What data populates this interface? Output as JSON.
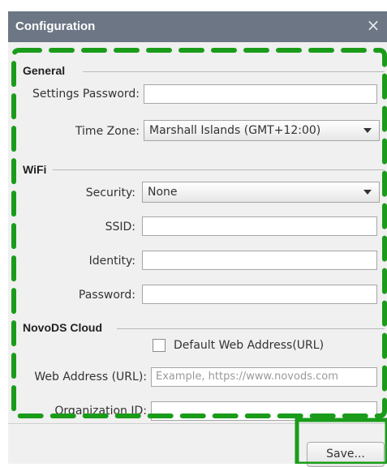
{
  "window": {
    "title": "Configuration",
    "close_glyph": "×"
  },
  "general": {
    "legend": "General",
    "settings_password_label": "Settings Password:",
    "settings_password_value": "",
    "time_zone_label": "Time Zone:",
    "time_zone_value": "Marshall Islands  (GMT+12:00)"
  },
  "wifi": {
    "legend": "WiFi",
    "security_label": "Security:",
    "security_value": "None",
    "ssid_label": "SSID:",
    "ssid_value": "",
    "identity_label": "Identity:",
    "identity_value": "",
    "password_label": "Password:",
    "password_value": ""
  },
  "cloud": {
    "legend": "NovoDS Cloud",
    "default_web_address_label": "Default Web Address(URL)",
    "default_web_address_checked": false,
    "web_address_label": "Web Address (URL):",
    "web_address_placeholder": "Example, https://www.novods.com",
    "organization_id_label": "Organization ID:",
    "organization_id_value": ""
  },
  "footer": {
    "save_label": "Save..."
  },
  "colors": {
    "titlebar": "#6c7684",
    "highlight": "#1a9c1a",
    "background": "#f0f0f0"
  }
}
